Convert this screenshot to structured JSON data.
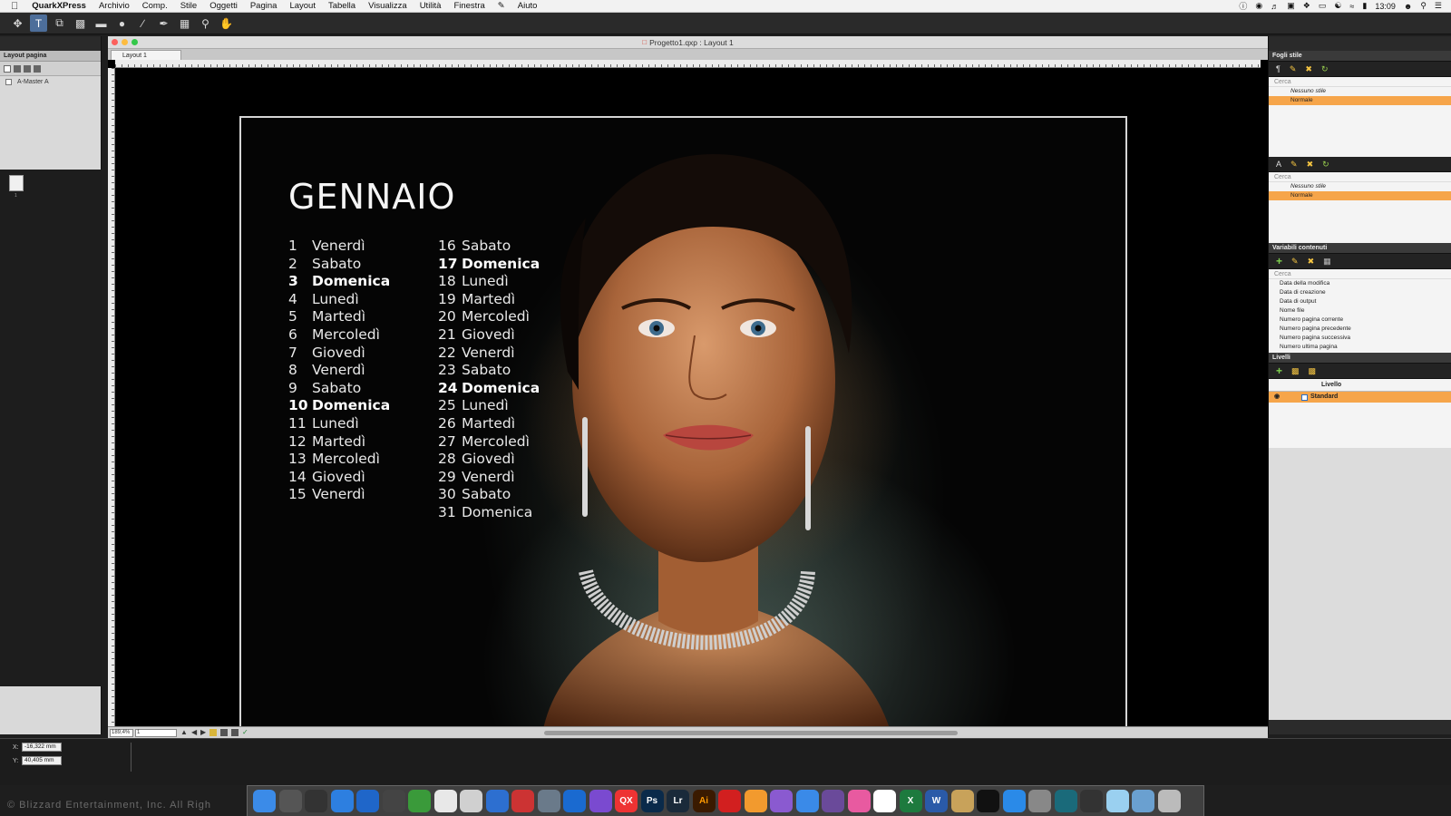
{
  "menubar": {
    "app_name": "QuarkXPress",
    "items": [
      "Archivio",
      "Comp.",
      "Stile",
      "Oggetti",
      "Pagina",
      "Layout",
      "Tabella",
      "Visualizza",
      "Utilità",
      "Finestra",
      "Aiuto"
    ],
    "clock": "13:09"
  },
  "left_panel": {
    "title": "Layout pagina",
    "master_item": "A-Master A",
    "page_thumb_number": "1"
  },
  "document": {
    "window_title": "Progetto1.qxp : Layout 1",
    "tab_label": "Layout 1",
    "zoom": "189,4%",
    "page": "1"
  },
  "calendar": {
    "month": "GENNAIO",
    "col1": [
      {
        "n": "1",
        "d": "Venerdì",
        "bold": false
      },
      {
        "n": "2",
        "d": "Sabato",
        "bold": false
      },
      {
        "n": "3",
        "d": "Domenica",
        "bold": true
      },
      {
        "n": "4",
        "d": "Lunedì",
        "bold": false
      },
      {
        "n": "5",
        "d": "Martedì",
        "bold": false
      },
      {
        "n": "6",
        "d": "Mercoledì",
        "bold": false
      },
      {
        "n": "7",
        "d": "Giovedì",
        "bold": false
      },
      {
        "n": "8",
        "d": "Venerdì",
        "bold": false
      },
      {
        "n": "9",
        "d": "Sabato",
        "bold": false
      },
      {
        "n": "10",
        "d": "Domenica",
        "bold": true
      },
      {
        "n": "11",
        "d": "Lunedì",
        "bold": false
      },
      {
        "n": "12",
        "d": "Martedì",
        "bold": false
      },
      {
        "n": "13",
        "d": "Mercoledì",
        "bold": false
      },
      {
        "n": "14",
        "d": "Giovedì",
        "bold": false
      },
      {
        "n": "15",
        "d": "Venerdì",
        "bold": false
      }
    ],
    "col2": [
      {
        "n": "16",
        "d": "Sabato",
        "bold": false
      },
      {
        "n": "17",
        "d": "Domenica",
        "bold": true
      },
      {
        "n": "18",
        "d": "Lunedì",
        "bold": false
      },
      {
        "n": "19",
        "d": "Martedì",
        "bold": false
      },
      {
        "n": "20",
        "d": "Mercoledì",
        "bold": false
      },
      {
        "n": "21",
        "d": "Giovedì",
        "bold": false
      },
      {
        "n": "22",
        "d": "Venerdì",
        "bold": false
      },
      {
        "n": "23",
        "d": "Sabato",
        "bold": false
      },
      {
        "n": "24",
        "d": "Domenica",
        "bold": true
      },
      {
        "n": "25",
        "d": "Lunedì",
        "bold": false
      },
      {
        "n": "26",
        "d": "Martedì",
        "bold": false
      },
      {
        "n": "27",
        "d": "Mercoledì",
        "bold": false
      },
      {
        "n": "28",
        "d": "Giovedì",
        "bold": false
      },
      {
        "n": "29",
        "d": "Venerdì",
        "bold": false
      },
      {
        "n": "30",
        "d": "Sabato",
        "bold": false
      },
      {
        "n": "31",
        "d": "Domenica",
        "bold": false
      }
    ]
  },
  "right_panel": {
    "style_sheets_title": "Fogli stile",
    "search_placeholder": "Cerca",
    "para_styles": [
      "Nessuno stile",
      "Normale"
    ],
    "char_styles": [
      "Nessuno stile",
      "Normale"
    ],
    "variables_title": "Variabili contenuti",
    "variables": [
      "Data della modifica",
      "Data di creazione",
      "Data di output",
      "Nome file",
      "Numero pagina corrente",
      "Numero pagina precedente",
      "Numero pagina successiva",
      "Numero ultima pagina"
    ],
    "layers_title": "Livelli",
    "layers_header": "Livello",
    "layer_name": "Standard"
  },
  "measurements": {
    "x_label": "X:",
    "x_value": "-16,322 mm",
    "y_label": "Y:",
    "y_value": "40,405 mm"
  },
  "background_text": "© Blizzard Entertainment, Inc. All Righ",
  "dock_icons": [
    "finder-icon",
    "launchpad-icon",
    "dashboard-icon",
    "safari-icon",
    "outlook-icon",
    "bbedit-icon",
    "evernote-icon",
    "chrome-icon",
    "mail-icon",
    "1password-icon",
    "fantastical-icon",
    "preview-icon",
    "xcode-icon",
    "affinity-icon",
    "quarkxpress-icon",
    "photoshop-icon",
    "lightroom-icon",
    "illustrator-icon",
    "creative-cloud-icon",
    "ibooks-icon",
    "spotlight-icon",
    "messages-icon",
    "alien-icon",
    "itunes-icon",
    "calendar-icon",
    "excel-icon",
    "word-icon",
    "archive-icon",
    "terminal-icon",
    "app-store-icon",
    "utility-icon",
    "display-icon",
    "quicktime-icon",
    "downloads-icon",
    "desktop-icon",
    "trash-icon"
  ],
  "dock_labels": {
    "quarkxpress": "QX",
    "photoshop": "Ps",
    "lightroom": "Lr",
    "illustrator": "Ai",
    "excel": "X",
    "word": "W"
  },
  "colors": {
    "selection_orange": "#f6a54a",
    "tool_active": "#4d6e9a",
    "panel_dark": "#2b2b2b"
  }
}
